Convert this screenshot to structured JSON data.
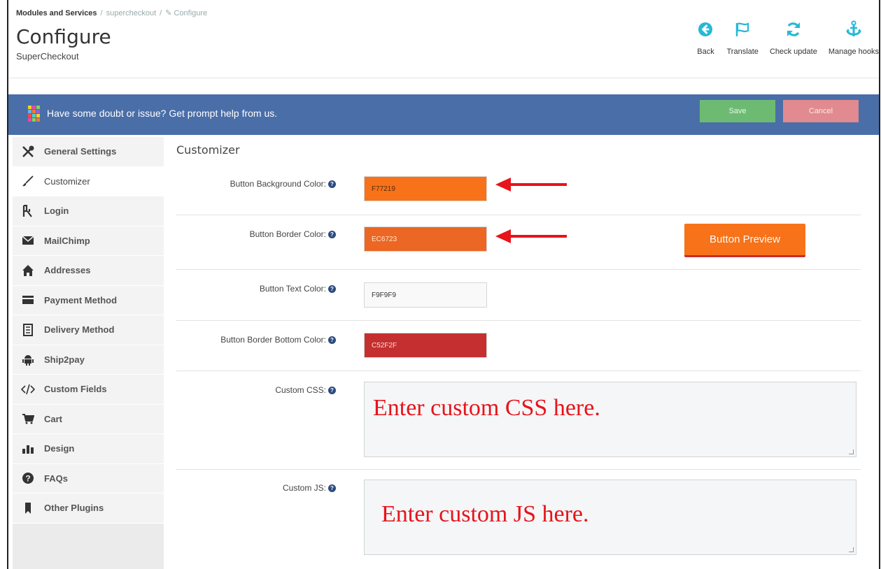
{
  "breadcrumb": {
    "root": "Modules and Services",
    "module": "supercheckout",
    "current": "Configure"
  },
  "page": {
    "title": "Configure",
    "subtitle": "SuperCheckout"
  },
  "toolbar": {
    "back_label": "Back",
    "translate_label": "Translate",
    "check_update_label": "Check update",
    "manage_hooks_label": "Manage hooks",
    "icon_color": "#25b9d7"
  },
  "helpbar": {
    "text": "Have some doubt or issue? Get prompt help from us.",
    "save_label": "Save",
    "cancel_label": "Cancel",
    "bg_color": "#4a6ea8"
  },
  "sidebar": {
    "items": [
      {
        "label": "General Settings",
        "icon": "tools-icon"
      },
      {
        "label": "Customizer",
        "icon": "brush-icon",
        "active": true
      },
      {
        "label": "Login",
        "icon": "key-icon"
      },
      {
        "label": "MailChimp",
        "icon": "envelope-icon"
      },
      {
        "label": "Addresses",
        "icon": "home-icon"
      },
      {
        "label": "Payment Method",
        "icon": "credit-card-icon"
      },
      {
        "label": "Delivery Method",
        "icon": "building-icon"
      },
      {
        "label": "Ship2pay",
        "icon": "android-icon"
      },
      {
        "label": "Custom Fields",
        "icon": "code-icon"
      },
      {
        "label": "Cart",
        "icon": "cart-icon"
      },
      {
        "label": "Design",
        "icon": "chart-icon"
      },
      {
        "label": "FAQs",
        "icon": "question-icon"
      },
      {
        "label": "Other Plugins",
        "icon": "bookmark-icon"
      }
    ]
  },
  "customizer": {
    "title": "Customizer",
    "fields": [
      {
        "label": "Button Background Color:",
        "value": "F77219",
        "color": "#f77219",
        "text_color": "#5a2a0a"
      },
      {
        "label": "Button Border Color:",
        "value": "EC6723",
        "color": "#ec6723",
        "text_color": "#fde6d6"
      },
      {
        "label": "Button Text Color:",
        "value": "F9F9F9",
        "color": "#f9f9f9",
        "text_color": "#333333"
      },
      {
        "label": "Button Border Bottom Color:",
        "value": "C52F2F",
        "color": "#c52f2f",
        "text_color": "#f5dede"
      }
    ],
    "preview_label": "Button Preview",
    "custom_css_label": "Custom CSS:",
    "custom_css_hint": "Enter custom CSS here.",
    "custom_js_label": "Custom JS:",
    "custom_js_hint": "Enter custom JS here.",
    "arrow_color": "#e8131b"
  }
}
